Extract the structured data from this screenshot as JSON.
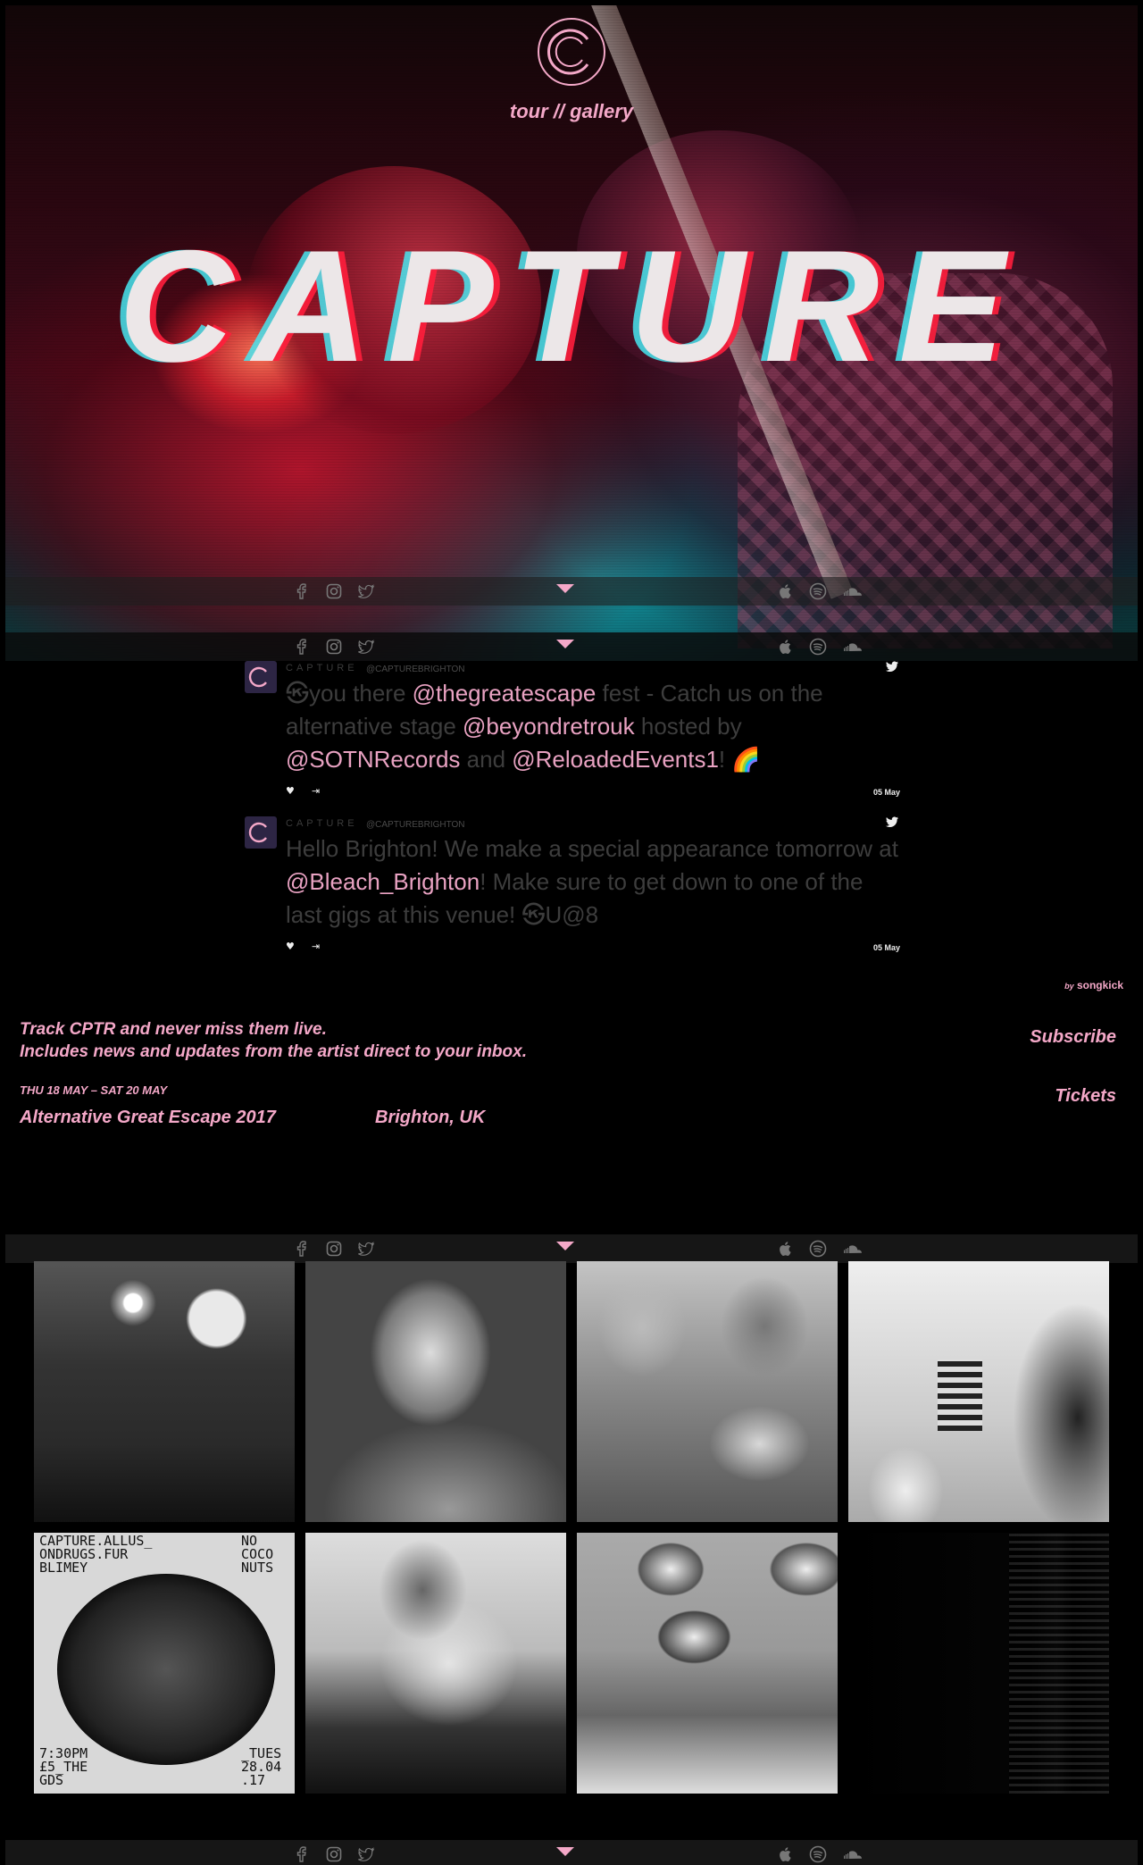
{
  "nav": {
    "tour": "tour",
    "sep": " // ",
    "gallery": "gallery"
  },
  "hero": {
    "title": "CAPTURE"
  },
  "social_icons": [
    "facebook-icon",
    "instagram-icon",
    "twitter-icon",
    "apple-music-icon",
    "spotify-icon",
    "soundcloud-icon"
  ],
  "tweets": [
    {
      "name": "CAPTURE",
      "handle": "@CAPTUREBRIGHTON",
      "parts": [
        {
          "t": "㉿you there "
        },
        {
          "t": "@thegreatescape",
          "m": true
        },
        {
          "t": " fest - Catch us on the alternative stage "
        },
        {
          "t": "@beyondretrouk",
          "m": true
        },
        {
          "t": " hosted by "
        },
        {
          "t": "@SOTNRecords",
          "m": true
        },
        {
          "t": " and "
        },
        {
          "t": "@ReloadedEvents1",
          "m": true
        },
        {
          "t": "! 🌈"
        }
      ],
      "date": "05 May"
    },
    {
      "name": "CAPTURE",
      "handle": "@CAPTUREBRIGHTON",
      "parts": [
        {
          "t": "Hello Brighton! We make a special appearance tomorrow at "
        },
        {
          "t": "@Bleach_Brighton",
          "m": true
        },
        {
          "t": "! Make sure to get down to one of the last gigs at this venue! ㉿U@8"
        }
      ],
      "date": "05 May"
    }
  ],
  "songkick": {
    "by": "by",
    "brand": "songkick"
  },
  "track": {
    "line1": "Track CPTR and never miss them live.",
    "line2": "Includes news and updates from the artist direct to your inbox.",
    "subscribe": "Subscribe"
  },
  "event": {
    "date": "THU 18 MAY – SAT 20 MAY",
    "name": "Alternative Great Escape 2017",
    "location": "Brighton, UK",
    "tickets": "Tickets"
  },
  "poster": {
    "top_left": "CAPTURE.ALLUS_\nONDRUGS.FUR\nBLIMEY",
    "top_right": "NO\nCOCO\nNUTS",
    "bottom_left": "7:30PM\n£5_THE\nGDS",
    "bottom_right": "_TUES\n28.04\n.17"
  },
  "colors": {
    "accent": "#f4a8c8",
    "background": "#000000"
  }
}
